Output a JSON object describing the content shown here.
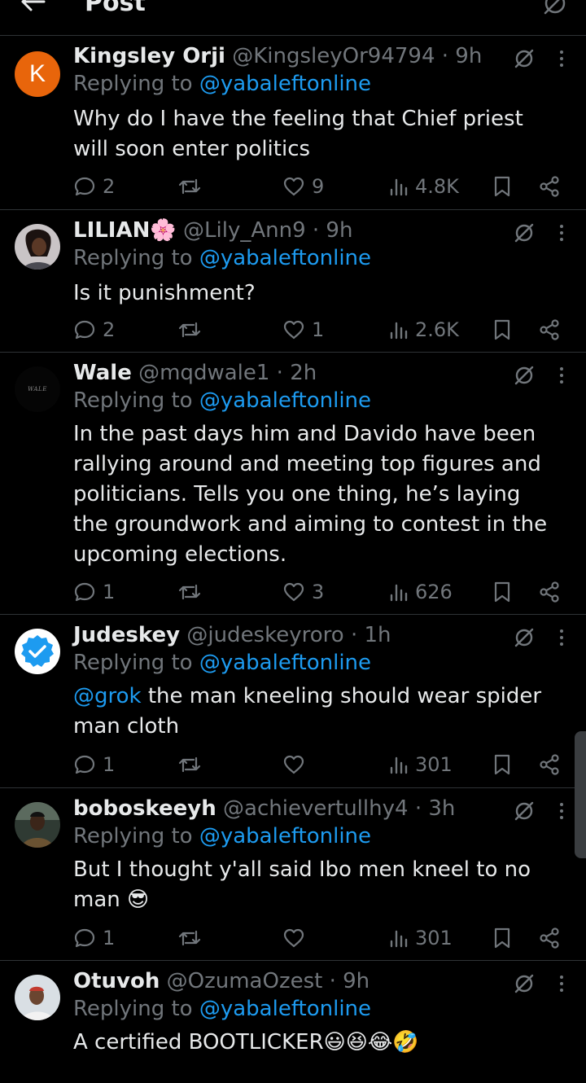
{
  "header": {
    "title": "Post"
  },
  "replies": [
    {
      "display_name": "Kingsley Orji",
      "handle": "@KingsleyOr94794",
      "time": "· 9h",
      "replying_prefix": "Replying to",
      "replying_to": "@yabaleftonline",
      "avatar_letter": "K",
      "text": "Why do I have the feeling that Chief priest will soon enter politics",
      "replies": "2",
      "reposts": "",
      "likes": "9",
      "views": "4.8K"
    },
    {
      "display_name": "LILIAN🌸",
      "handle": "@Lily_Ann9",
      "time": "· 9h",
      "replying_prefix": "Replying to",
      "replying_to": "@yabaleftonline",
      "text": "Is it punishment?",
      "replies": "2",
      "reposts": "",
      "likes": "1",
      "views": "2.6K"
    },
    {
      "display_name": "Wale",
      "handle": "@mqdwale1",
      "time": "· 2h",
      "replying_prefix": "Replying to",
      "replying_to": "@yabaleftonline",
      "avatar_text": "WALE",
      "text": "In the past days him and Davido have been rallying around and meeting top figures and politicians. Tells you one thing, he’s laying the groundwork and aiming to contest in the upcoming elections.",
      "replies": "1",
      "reposts": "",
      "likes": "3",
      "views": "626"
    },
    {
      "display_name": "Judeskey",
      "handle": "@judeskeyroro",
      "time": "· 1h",
      "replying_prefix": "Replying to",
      "replying_to": "@yabaleftonline",
      "text_mention": "@grok",
      "text": " the man kneeling should wear spider man cloth",
      "replies": "1",
      "reposts": "",
      "likes": "",
      "views": "301"
    },
    {
      "display_name": "boboskeeyh",
      "handle": "@achievertullhy4",
      "time": "· 3h",
      "replying_prefix": "Replying to",
      "replying_to": "@yabaleftonline",
      "text": "But I thought y'all said Ibo men kneel to no man 😎",
      "replies": "1",
      "reposts": "",
      "likes": "",
      "views": "301"
    },
    {
      "display_name": "Otuvoh",
      "handle": "@OzumaOzest",
      "time": "· 9h",
      "replying_prefix": "Replying to",
      "replying_to": "@yabaleftonline",
      "text": "A certified BOOTLICKER😃😆😂🤣"
    }
  ],
  "colors": {
    "accent": "#1d9bf0",
    "muted": "#71767b",
    "text": "#e7e9ea",
    "divider": "#2f3336",
    "avatar_k": "#e8650b"
  },
  "icons": [
    "back-arrow-icon",
    "grok-icon",
    "more-icon",
    "reply-icon",
    "repost-icon",
    "like-icon",
    "views-icon",
    "bookmark-icon",
    "share-icon",
    "verified-badge-icon"
  ]
}
